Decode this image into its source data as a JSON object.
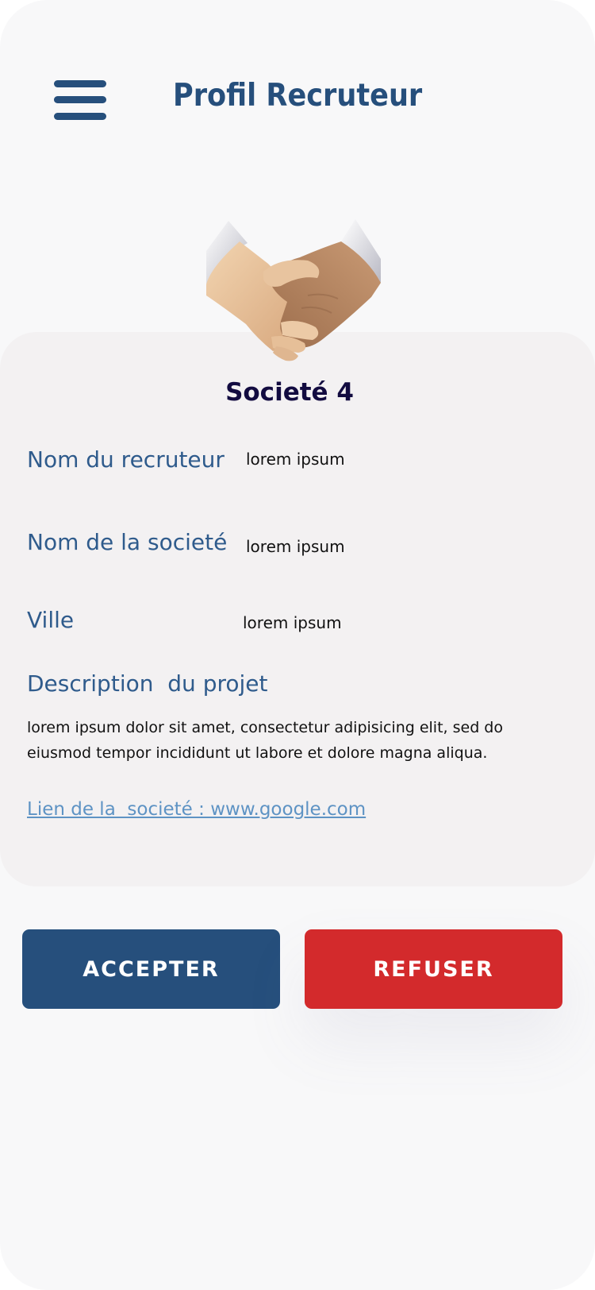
{
  "header": {
    "title": "Profil Recruteur",
    "menu_icon": "hamburger-menu-icon"
  },
  "profile": {
    "illustration": "handshake-emoji",
    "company_title": "Societé 4",
    "fields": [
      {
        "label": "Nom du recruteur",
        "value": "lorem ipsum"
      },
      {
        "label": "Nom de la societé",
        "value": "lorem ipsum"
      },
      {
        "label": "Ville",
        "value": "lorem ipsum"
      }
    ],
    "description_label": "Description  du projet",
    "description_text": "lorem ipsum dolor sit amet, consectetur adipisicing elit, sed do eiusmod tempor incididunt ut labore et dolore magna aliqua.",
    "link_text": "Lien de la  societé : www.google.com"
  },
  "actions": {
    "accept_label": "ACCEPTER",
    "refuse_label": "REFUSER"
  },
  "colors": {
    "primary": "#264f7c",
    "danger": "#d32a2c",
    "card_bg": "#f3f1f2",
    "link": "#5e93c4"
  }
}
